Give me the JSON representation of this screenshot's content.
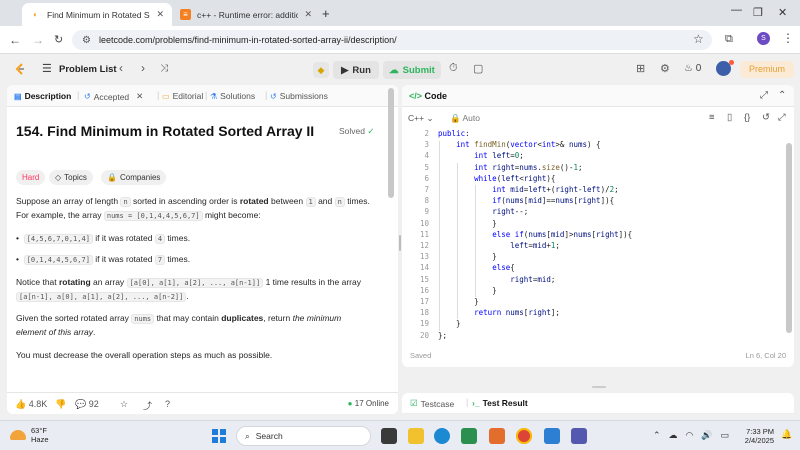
{
  "browser": {
    "tabs": [
      {
        "title": "Find Minimum in Rotated Sorte",
        "active": true
      },
      {
        "title": "c++ - Runtime error: addition o",
        "active": false
      }
    ],
    "url": "leetcode.com/problems/find-minimum-in-rotated-sorted-array-ii/description/",
    "profile_initial": "S"
  },
  "nav": {
    "problem_list": "Problem List",
    "run_label": "Run",
    "submit_label": "Submit",
    "streak_count": "0",
    "premium_label": "Premium"
  },
  "left_tabs": [
    "Description",
    "Accepted",
    "Editorial",
    "Solutions",
    "Submissions"
  ],
  "problem": {
    "title": "154. Find Minimum in Rotated Sorted Array II",
    "solved_label": "Solved",
    "difficulty": "Hard",
    "topics_label": "Topics",
    "companies_label": "Companies",
    "p1": {
      "a": "Suppose an array of length ",
      "n": "n",
      "b": " sorted in ascending order is ",
      "rotated": "rotated",
      "c": " between ",
      "one": "1",
      "d": " and ",
      "n2": "n",
      "e": " times.",
      "f": "For example, the array ",
      "nums": "nums = [0,1,4,4,5,6,7]",
      "g": " might become:"
    },
    "bullets": [
      {
        "code": "[4,5,6,7,0,1,4]",
        "a": " if it was rotated ",
        "k": "4",
        "b": " times."
      },
      {
        "code": "[0,1,4,4,5,6,7]",
        "a": " if it was rotated ",
        "k": "7",
        "b": " times."
      }
    ],
    "p2": {
      "a": "Notice that ",
      "rotating": "rotating",
      "b": " an array ",
      "code1": "[a[0], a[1], a[2], ..., a[n-1]]",
      "c": " 1 time results in the array",
      "code2": "[a[n-1], a[0], a[1], a[2], ..., a[n-2]]",
      "d": "."
    },
    "p3": {
      "a": "Given the sorted rotated array ",
      "nums": "nums",
      "b": " that may contain ",
      "dup": "duplicates",
      "c": ", return ",
      "em": "the minimum",
      "em2": "element of this array",
      "d": "."
    },
    "p4": "You must decrease the overall operation steps as much as possible."
  },
  "footer": {
    "likes": "4.8K",
    "comments": "92",
    "online": "17 Online"
  },
  "editor": {
    "panel_title": "Code",
    "language": "C++",
    "mode": "Auto",
    "status": "Saved",
    "cursor": "Ln 6, Col 20",
    "lines": [
      {
        "n": "2",
        "html": "<span class='kw'>public</span>:",
        "indent": 0
      },
      {
        "n": "3",
        "html": "    <span class='ty'>int</span> <span class='fn'>findMin</span>(<span class='ty'>vector</span>&lt;<span class='ty'>int</span>&gt;&amp; <span class='var'>nums</span>) {",
        "indent": 0
      },
      {
        "n": "4",
        "html": "        <span class='ty'>int</span> <span class='var'>left</span>=<span class='num'>0</span>;",
        "indent": 0
      },
      {
        "n": "5",
        "html": "        <span class='ty'>int</span> <span class='var'>right</span>=<span class='var'>nums</span>.<span class='fn'>size</span>()-<span class='num'>1</span>;",
        "indent": 0
      },
      {
        "n": "6",
        "html": "        <span class='kw'>while</span>(<span class='var'>left</span>&lt;<span class='var'>right</span>){",
        "indent": 0
      },
      {
        "n": "7",
        "html": "            <span class='ty'>int</span> <span class='var'>mid</span>=<span class='var'>left</span>+(<span class='var'>right</span>-<span class='var'>left</span>)/<span class='num'>2</span>;",
        "indent": 0
      },
      {
        "n": "8",
        "html": "            <span class='kw'>if</span>(<span class='var'>nums</span>[<span class='var'>mid</span>]==<span class='var'>nums</span>[<span class='var'>right</span>]){",
        "indent": 0
      },
      {
        "n": "9",
        "html": "            <span class='var'>right</span>--;",
        "indent": 0
      },
      {
        "n": "10",
        "html": "            }",
        "indent": 0
      },
      {
        "n": "11",
        "html": "            <span class='kw'>else if</span>(<span class='var'>nums</span>[<span class='var'>mid</span>]&gt;<span class='var'>nums</span>[<span class='var'>right</span>]){",
        "indent": 0
      },
      {
        "n": "12",
        "html": "                <span class='var'>left</span>=<span class='var'>mid</span>+<span class='num'>1</span>;",
        "indent": 0
      },
      {
        "n": "13",
        "html": "            }",
        "indent": 0
      },
      {
        "n": "14",
        "html": "            <span class='kw'>else</span>{",
        "indent": 0
      },
      {
        "n": "15",
        "html": "                <span class='var'>right</span>=<span class='var'>mid</span>;",
        "indent": 0
      },
      {
        "n": "16",
        "html": "            }",
        "indent": 0
      },
      {
        "n": "17",
        "html": "        }",
        "indent": 0
      },
      {
        "n": "18",
        "html": "        <span class='kw'>return</span> <span class='var'>nums</span>[<span class='var'>right</span>];",
        "indent": 0
      },
      {
        "n": "19",
        "html": "    }",
        "indent": 0
      },
      {
        "n": "20",
        "html": "};",
        "indent": 0
      }
    ]
  },
  "bottom_tabs": [
    "Testcase",
    "Test Result"
  ],
  "taskbar": {
    "temp": "63°F",
    "condition": "Haze",
    "search_placeholder": "Search",
    "time": "7:33 PM",
    "date": "2/4/2025"
  },
  "colors": {
    "accent_green": "#2db55d",
    "hard_red": "#ff375f",
    "premium_orange": "#e8a034"
  }
}
